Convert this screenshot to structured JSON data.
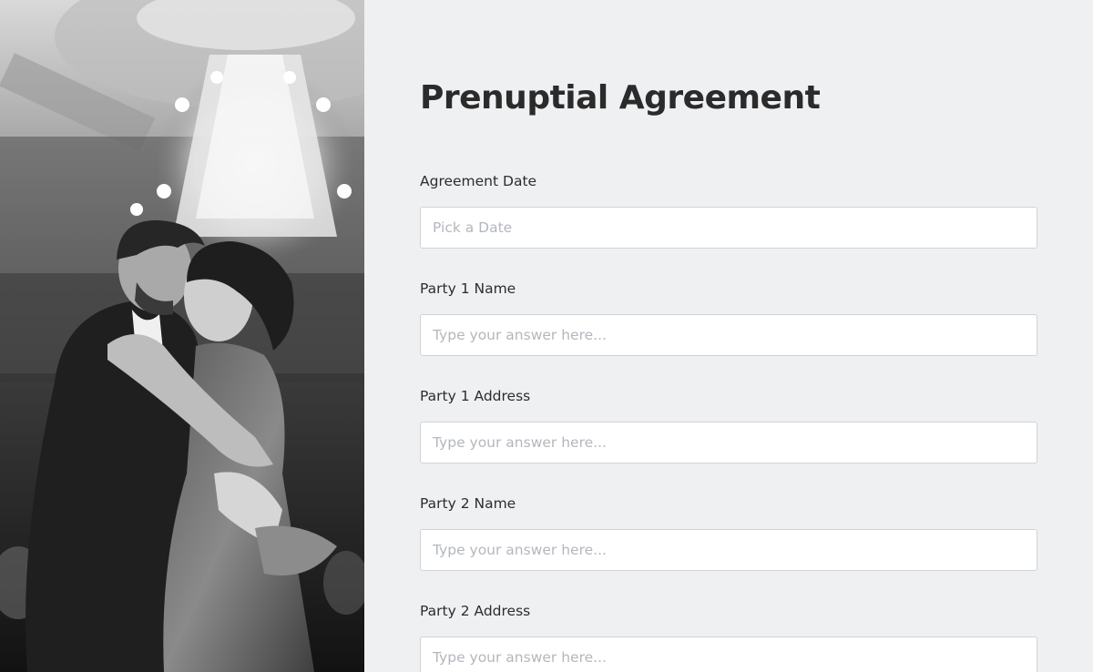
{
  "photo": {
    "alt": "Couple dancing under a chandelier"
  },
  "form": {
    "title": "Prenuptial Agreement",
    "fields": [
      {
        "label": "Agreement Date",
        "placeholder": "Pick a Date",
        "value": ""
      },
      {
        "label": "Party 1 Name",
        "placeholder": "Type your answer here...",
        "value": ""
      },
      {
        "label": "Party 1 Address",
        "placeholder": "Type your answer here...",
        "value": ""
      },
      {
        "label": "Party 2 Name",
        "placeholder": "Type your answer here...",
        "value": ""
      },
      {
        "label": "Party 2 Address",
        "placeholder": "Type your answer here...",
        "value": ""
      }
    ]
  },
  "colors": {
    "background": "#eff0f2",
    "input_border": "#cfd3d8",
    "title_text": "#2b2b2b",
    "placeholder": "#b3b7bd"
  }
}
